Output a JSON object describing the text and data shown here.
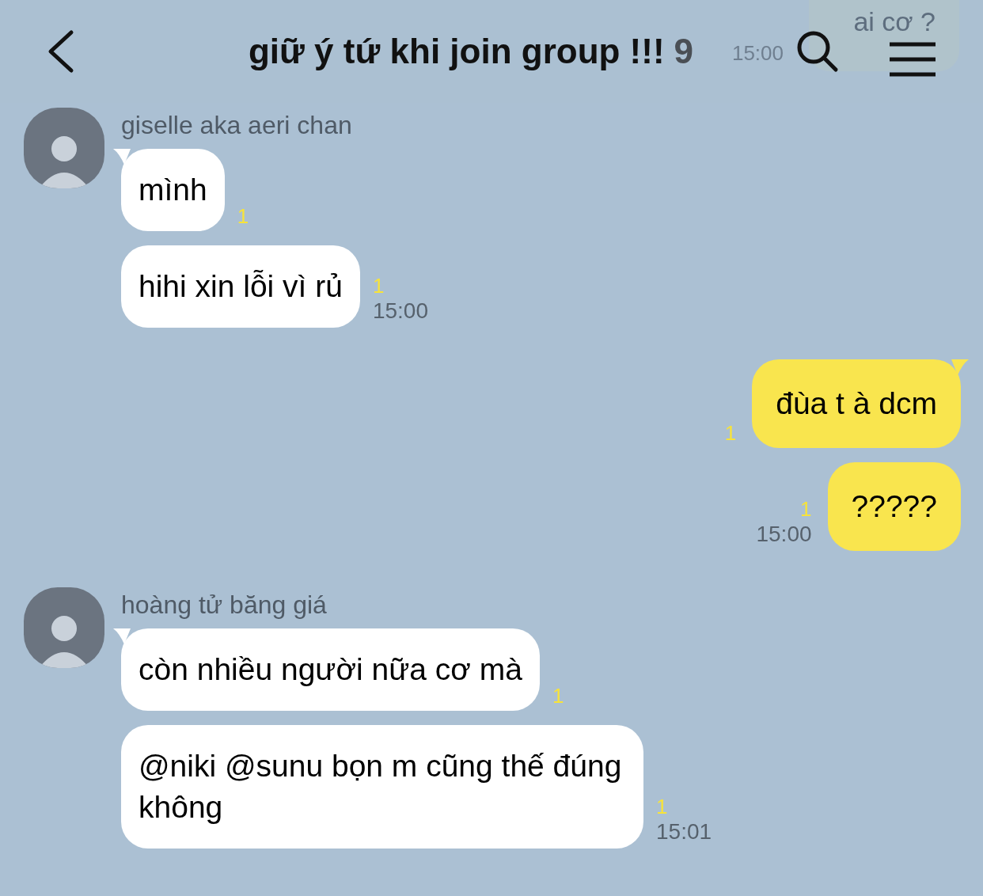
{
  "header": {
    "title": "giữ ý tứ khi join group !!!",
    "member_count": "9"
  },
  "faded_message": {
    "text": "ai cơ ?",
    "time": "15:00"
  },
  "messages": [
    {
      "kind": "incoming",
      "sender": "giselle aka aeri chan",
      "bubbles": [
        {
          "text": "mình",
          "unread": "1"
        },
        {
          "text": "hihi xin lỗi vì rủ",
          "unread": "1",
          "time": "15:00"
        }
      ]
    },
    {
      "kind": "outgoing",
      "bubbles": [
        {
          "text": "đùa t à dcm",
          "unread": "1"
        },
        {
          "text": "?????",
          "unread": "1",
          "time": "15:00"
        }
      ]
    },
    {
      "kind": "incoming",
      "sender": "hoàng tử băng giá",
      "bubbles": [
        {
          "text": "còn nhiều người nữa cơ mà",
          "unread": "1"
        },
        {
          "text": "@niki @sunu bọn m cũng thế đúng không",
          "unread": "1",
          "time": "15:01"
        }
      ]
    }
  ]
}
